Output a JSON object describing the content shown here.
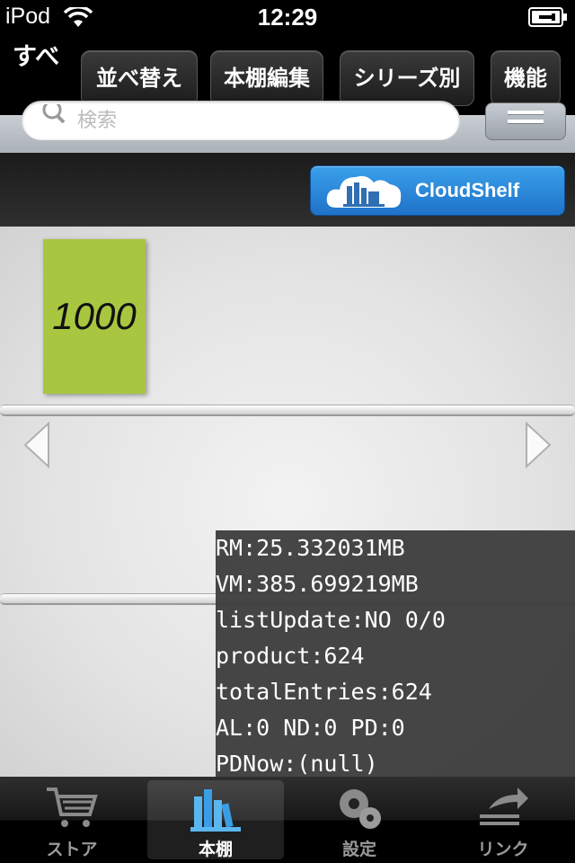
{
  "status_bar": {
    "carrier": "iPod",
    "time": "12:29"
  },
  "toolbar": {
    "all_label": "すべ",
    "buttons": [
      "並べ替え",
      "本棚編集",
      "シリーズ別",
      "機能"
    ]
  },
  "search": {
    "placeholder": "検索"
  },
  "cloudshelf": {
    "label": "CloudShelf"
  },
  "shelf": {
    "books": [
      {
        "title": "1000",
        "cover_color": "#a8c640"
      }
    ]
  },
  "debug": {
    "lines": [
      "RM:25.332031MB",
      "VM:385.699219MB",
      "listUpdate:NO 0/0",
      "product:624",
      "totalEntries:624",
      "AL:0 ND:0 PD:0",
      "PDNow:(null)"
    ]
  },
  "tabbar": {
    "tabs": [
      {
        "label": "ストア",
        "icon": "cart-icon",
        "selected": false
      },
      {
        "label": "本棚",
        "icon": "bookshelf-icon",
        "selected": true
      },
      {
        "label": "設定",
        "icon": "gear-icon",
        "selected": false
      },
      {
        "label": "リンク",
        "icon": "link-icon",
        "selected": false
      }
    ]
  },
  "colors": {
    "accent_blue": "#2a8ae0",
    "book_green": "#a8c640"
  }
}
